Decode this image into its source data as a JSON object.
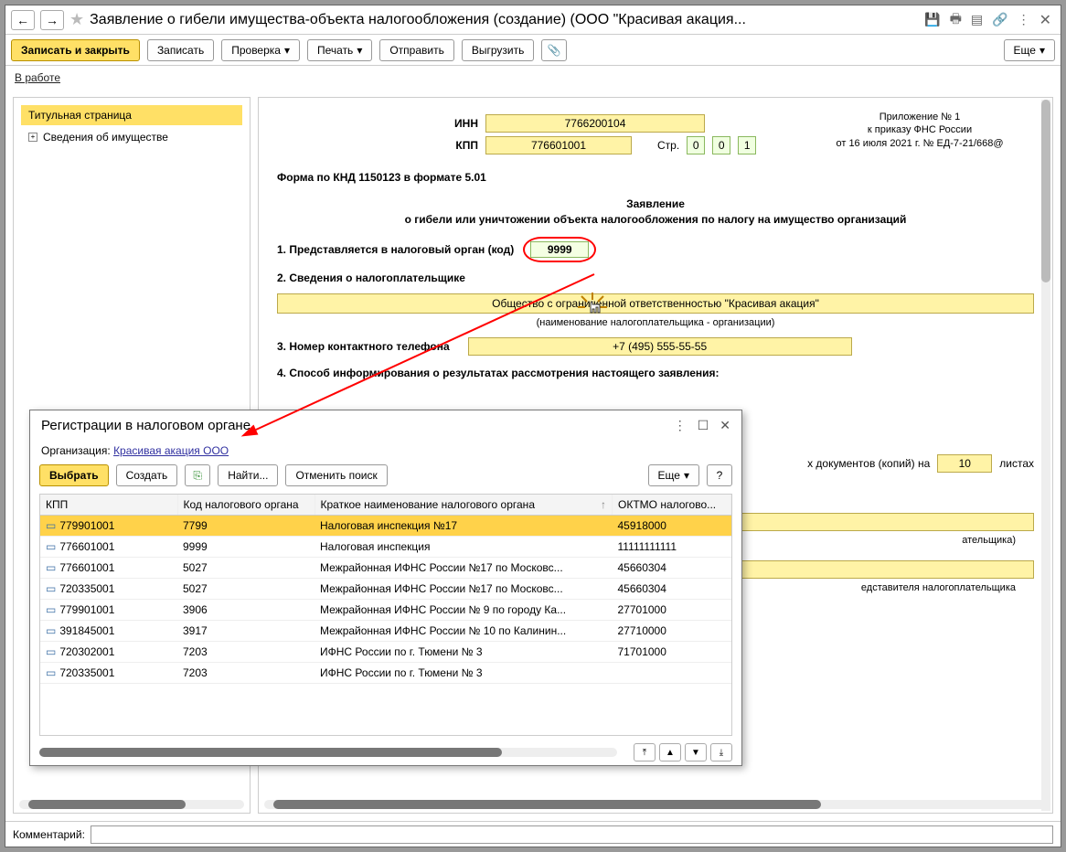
{
  "titlebar": {
    "title": "Заявление о гибели имущества-объекта налогообложения (создание) (ООО \"Красивая акация..."
  },
  "toolbar": {
    "save_close": "Записать и закрыть",
    "save": "Записать",
    "check": "Проверка",
    "print": "Печать",
    "send": "Отправить",
    "export": "Выгрузить",
    "more": "Еще"
  },
  "status": {
    "label": "В работе"
  },
  "sidebar": {
    "items": [
      "Титульная страница",
      "Сведения об имуществе"
    ]
  },
  "form": {
    "inn_label": "ИНН",
    "inn": "7766200104",
    "kpp_label": "КПП",
    "kpp": "776601001",
    "page_label": "Стр.",
    "page": [
      "0",
      "0",
      "1"
    ],
    "appendix": [
      "Приложение № 1",
      "к приказу ФНС России",
      "от 16 июля 2021 г. № ЕД-7-21/668@"
    ],
    "knd": "Форма по КНД 1150123 в формате 5.01",
    "title1": "Заявление",
    "title2": "о гибели или уничтожении объекта налогообложения по налогу на имущество организаций",
    "row1_label": "1. Представляется в налоговый орган (код)",
    "row1_value": "9999",
    "row2_label": "2. Сведения о налогоплательщике",
    "org_name": "Общество с ограниченной ответственностью \"Красивая акация\"",
    "org_name_note": "(наименование налогоплательщика - организации)",
    "row3_label": "3. Номер контактного телефона",
    "phone": "+7 (495) 555-55-55",
    "row4_label": "4. Способ информирования о результатах рассмотрения настоящего заявления:",
    "docs_tail": "х документов (копий) на",
    "docs_count": "10",
    "docs_unit": "листах",
    "rep_note1": "ательщика)",
    "rep_note2": "едставителя налогоплательщика"
  },
  "dialog": {
    "title": "Регистрации в налоговом органе",
    "org_label": "Организация:",
    "org_value": "Красивая акация ООО",
    "buttons": {
      "select": "Выбрать",
      "create": "Создать",
      "find": "Найти...",
      "cancel_search": "Отменить поиск",
      "more": "Еще",
      "help": "?"
    },
    "cols": [
      "КПП",
      "Код налогового органа",
      "Краткое наименование налогового органа",
      "ОКТМО налогово..."
    ],
    "rows": [
      {
        "kpp": "779901001",
        "code": "7799",
        "name": "Налоговая инспекция №17",
        "oktmo": "45918000"
      },
      {
        "kpp": "776601001",
        "code": "9999",
        "name": "Налоговая инспекция",
        "oktmo": "11111111111"
      },
      {
        "kpp": "776601001",
        "code": "5027",
        "name": "Межрайонная ИФНС России №17 по Московс...",
        "oktmo": "45660304"
      },
      {
        "kpp": "720335001",
        "code": "5027",
        "name": "Межрайонная ИФНС России №17 по Московс...",
        "oktmo": "45660304"
      },
      {
        "kpp": "779901001",
        "code": "3906",
        "name": "Межрайонная ИФНС России № 9 по городу Ка...",
        "oktmo": "27701000"
      },
      {
        "kpp": "391845001",
        "code": "3917",
        "name": "Межрайонная ИФНС России № 10 по Калинин...",
        "oktmo": "27710000"
      },
      {
        "kpp": "720302001",
        "code": "7203",
        "name": "ИФНС России по г. Тюмени № 3",
        "oktmo": "71701000"
      },
      {
        "kpp": "720335001",
        "code": "7203",
        "name": "ИФНС России по г. Тюмени № 3",
        "oktmo": ""
      }
    ]
  },
  "comment": {
    "label": "Комментарий:"
  }
}
